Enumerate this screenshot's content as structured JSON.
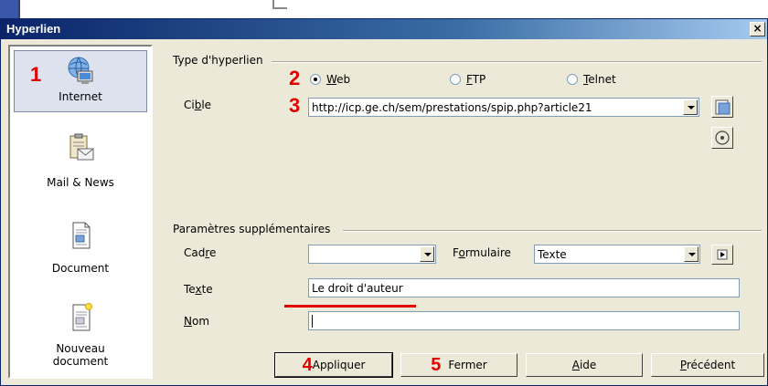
{
  "dialog": {
    "title": "Hyperlien",
    "close_glyph": "×"
  },
  "sidebar": {
    "items": [
      {
        "label": "Internet",
        "icon": "globe-monitor-icon",
        "selected": true,
        "marker": "1"
      },
      {
        "label": "Mail & News",
        "icon": "clipboard-envelope-icon"
      },
      {
        "label": "Document",
        "icon": "document-icon"
      },
      {
        "label_line1": "Nouveau",
        "label_line2": "document",
        "icon": "new-document-icon"
      }
    ]
  },
  "type_group": {
    "title": "Type d'hyperlien",
    "marker_radio": "2",
    "options": [
      {
        "label": "Web",
        "checked": true
      },
      {
        "label": "FTP",
        "checked": false
      },
      {
        "label": "Telnet",
        "checked": false
      }
    ],
    "target_label": "Cible",
    "marker_target": "3",
    "target_value": "http://icp.ge.ch/sem/prestations/spip.php?article21"
  },
  "extra_group": {
    "title": "Paramètres supplémentaires",
    "frame_label": "Cadre",
    "frame_value": "",
    "form_label": "Formulaire",
    "form_value": "Texte",
    "text_label": "Texte",
    "text_value": "Le droit d'auteur",
    "name_label": "Nom",
    "name_value": ""
  },
  "buttons": {
    "apply": {
      "label": "Appliquer",
      "marker": "4"
    },
    "close": {
      "label": "Fermer",
      "marker": "5"
    },
    "help": {
      "label": "Aide"
    },
    "back": {
      "label": "Précédent"
    }
  },
  "colors": {
    "titlebar": "#0a246a",
    "dialog_bg": "#ece9d8",
    "annotation": "#e00000"
  }
}
